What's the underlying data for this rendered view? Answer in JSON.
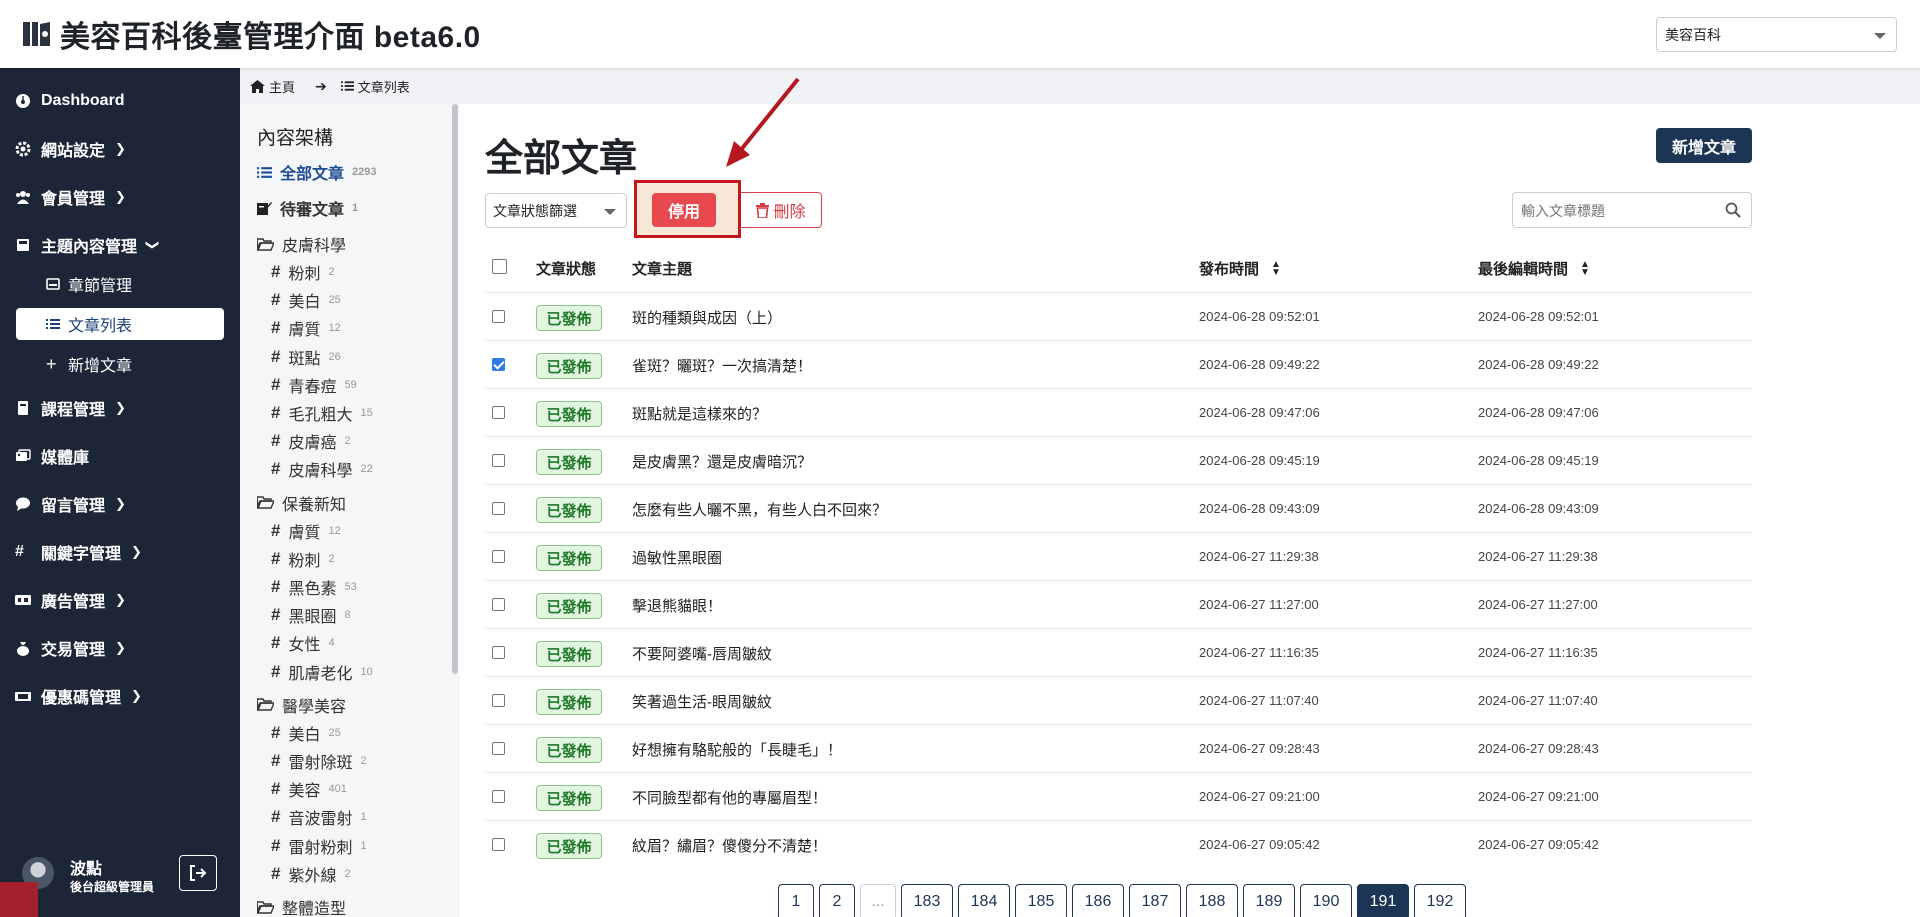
{
  "app": {
    "title": "美容百科後臺管理介面 beta6.0",
    "site_select_value": "美容百科"
  },
  "sidebar": {
    "items": [
      {
        "label": "Dashboard",
        "icon": "dashboard-icon"
      },
      {
        "label": "網站設定",
        "icon": "gear-icon"
      },
      {
        "label": "會員管理",
        "icon": "users-icon"
      },
      {
        "label": "主題內容管理",
        "icon": "book-icon"
      },
      {
        "label": "課程管理",
        "icon": "book-icon"
      },
      {
        "label": "媒體庫",
        "icon": "images-icon"
      },
      {
        "label": "留言管理",
        "icon": "comment-icon"
      },
      {
        "label": "關鍵字管理",
        "icon": "hash-icon"
      },
      {
        "label": "廣告管理",
        "icon": "ad-icon"
      },
      {
        "label": "交易管理",
        "icon": "moneybag-icon"
      },
      {
        "label": "優惠碼管理",
        "icon": "ticket-icon"
      }
    ],
    "subitems": [
      {
        "label": "章節管理"
      },
      {
        "label": "文章列表"
      },
      {
        "label": "新增文章"
      }
    ],
    "user": {
      "name": "波點",
      "role": "後台超級管理員"
    }
  },
  "breadcrumb": {
    "home": "主頁",
    "current": "文章列表"
  },
  "categories": {
    "heading": "內容架構",
    "all": {
      "label": "全部文章",
      "count": "2293"
    },
    "pending": {
      "label": "待審文章",
      "count": "1"
    },
    "groups": [
      {
        "label": "皮膚科學",
        "tags": [
          {
            "label": "粉刺",
            "count": "2"
          },
          {
            "label": "美白",
            "count": "25"
          },
          {
            "label": "膚質",
            "count": "12"
          },
          {
            "label": "斑點",
            "count": "26"
          },
          {
            "label": "青春痘",
            "count": "59"
          },
          {
            "label": "毛孔粗大",
            "count": "15"
          },
          {
            "label": "皮膚癌",
            "count": "2"
          },
          {
            "label": "皮膚科學",
            "count": "22"
          }
        ]
      },
      {
        "label": "保養新知",
        "tags": [
          {
            "label": "膚質",
            "count": "12"
          },
          {
            "label": "粉刺",
            "count": "2"
          },
          {
            "label": "黑色素",
            "count": "53"
          },
          {
            "label": "黑眼圈",
            "count": "8"
          },
          {
            "label": "女性",
            "count": "4"
          },
          {
            "label": "肌膚老化",
            "count": "10"
          }
        ]
      },
      {
        "label": "醫學美容",
        "tags": [
          {
            "label": "美白",
            "count": "25"
          },
          {
            "label": "雷射除斑",
            "count": "2"
          },
          {
            "label": "美容",
            "count": "401"
          },
          {
            "label": "音波雷射",
            "count": "1"
          },
          {
            "label": "雷射粉刺",
            "count": "1"
          },
          {
            "label": "紫外線",
            "count": "2"
          }
        ]
      },
      {
        "label": "整體造型",
        "tags": []
      }
    ]
  },
  "main": {
    "title": "全部文章",
    "new_button": "新增文章",
    "status_filter": "文章狀態篩選",
    "disable_button": "停用",
    "delete_button": "刪除",
    "search_placeholder": "輸入文章標題",
    "columns": {
      "status": "文章狀態",
      "title": "文章主題",
      "published": "發布時間",
      "edited": "最後編輯時間"
    },
    "rows": [
      {
        "status": "已發佈",
        "title": "斑的種類與成因（上）",
        "published": "2024-06-28 09:52:01",
        "edited": "2024-06-28 09:52:01",
        "checked": false
      },
      {
        "status": "已發佈",
        "title": "雀斑？曬斑？一次搞清楚！",
        "published": "2024-06-28 09:49:22",
        "edited": "2024-06-28 09:49:22",
        "checked": true
      },
      {
        "status": "已發佈",
        "title": "斑點就是這樣來的？",
        "published": "2024-06-28 09:47:06",
        "edited": "2024-06-28 09:47:06",
        "checked": false
      },
      {
        "status": "已發佈",
        "title": "是皮膚黑？還是皮膚暗沉？",
        "published": "2024-06-28 09:45:19",
        "edited": "2024-06-28 09:45:19",
        "checked": false
      },
      {
        "status": "已發佈",
        "title": "怎麼有些人曬不黑，有些人白不回來？",
        "published": "2024-06-28 09:43:09",
        "edited": "2024-06-28 09:43:09",
        "checked": false
      },
      {
        "status": "已發佈",
        "title": "過敏性黑眼圈",
        "published": "2024-06-27 11:29:38",
        "edited": "2024-06-27 11:29:38",
        "checked": false
      },
      {
        "status": "已發佈",
        "title": "擊退熊貓眼！",
        "published": "2024-06-27 11:27:00",
        "edited": "2024-06-27 11:27:00",
        "checked": false
      },
      {
        "status": "已發佈",
        "title": "不要阿婆嘴-唇周皺紋",
        "published": "2024-06-27 11:16:35",
        "edited": "2024-06-27 11:16:35",
        "checked": false
      },
      {
        "status": "已發佈",
        "title": "笑著過生活-眼周皺紋",
        "published": "2024-06-27 11:07:40",
        "edited": "2024-06-27 11:07:40",
        "checked": false
      },
      {
        "status": "已發佈",
        "title": "好想擁有駱駝般的「長睫毛」！",
        "published": "2024-06-27 09:28:43",
        "edited": "2024-06-27 09:28:43",
        "checked": false
      },
      {
        "status": "已發佈",
        "title": "不同臉型都有他的專屬眉型！",
        "published": "2024-06-27 09:21:00",
        "edited": "2024-06-27 09:21:00",
        "checked": false
      },
      {
        "status": "已發佈",
        "title": "紋眉？繡眉？傻傻分不清楚！",
        "published": "2024-06-27 09:05:42",
        "edited": "2024-06-27 09:05:42",
        "checked": false
      }
    ],
    "pagination": [
      "1",
      "2",
      "...",
      "183",
      "184",
      "185",
      "186",
      "187",
      "188",
      "189",
      "190",
      "191",
      "192"
    ],
    "current_page": "191"
  },
  "colors": {
    "sidebar_bg": "#1d2637",
    "primary": "#1d3555",
    "danger": "#e8494f",
    "highlight_border": "#c4161c",
    "published_green": "#1d7a26"
  }
}
